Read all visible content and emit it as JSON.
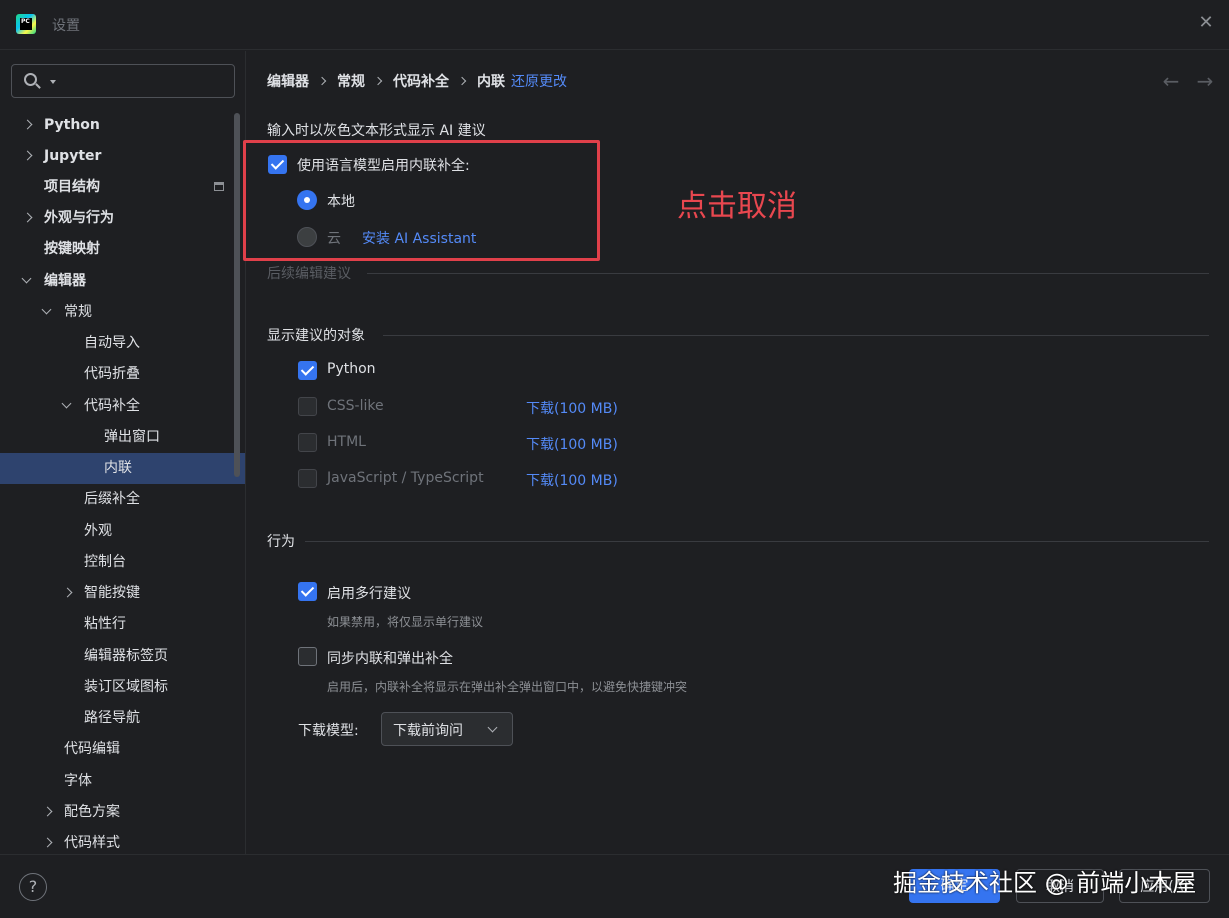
{
  "window": {
    "title": "设置",
    "logo_text": "PC"
  },
  "search": {
    "placeholder": ""
  },
  "sidebar": {
    "items": [
      {
        "label": "Python"
      },
      {
        "label": "Jupyter"
      },
      {
        "label": "项目结构"
      },
      {
        "label": "外观与行为"
      },
      {
        "label": "按键映射"
      },
      {
        "label": "编辑器"
      },
      {
        "label": "常规"
      },
      {
        "label": "自动导入"
      },
      {
        "label": "代码折叠"
      },
      {
        "label": "代码补全"
      },
      {
        "label": "弹出窗口"
      },
      {
        "label": "内联",
        "selected": true
      },
      {
        "label": "后缀补全"
      },
      {
        "label": "外观"
      },
      {
        "label": "控制台"
      },
      {
        "label": "智能按键"
      },
      {
        "label": "粘性行"
      },
      {
        "label": "编辑器标签页"
      },
      {
        "label": "装订区域图标"
      },
      {
        "label": "路径导航"
      },
      {
        "label": "代码编辑"
      },
      {
        "label": "字体"
      },
      {
        "label": "配色方案"
      },
      {
        "label": "代码样式"
      }
    ]
  },
  "breadcrumb": {
    "items": [
      "编辑器",
      "常规",
      "代码补全",
      "内联"
    ],
    "restore": "还原更改"
  },
  "main": {
    "hint": "输入时以灰色文本形式显示 AI 建议",
    "inline_completion": {
      "label": "使用语言模型启用内联补全:",
      "checked": true
    },
    "radio_local": {
      "label": "本地",
      "selected": true
    },
    "radio_cloud": {
      "label": "云",
      "selected": false
    },
    "install_link": "安装 AI Assistant",
    "followup_section": "后续编辑建议",
    "languages_section": "显示建议的对象",
    "languages": [
      {
        "label": "Python",
        "checked": true,
        "enabled": true,
        "download": ""
      },
      {
        "label": "CSS-like",
        "checked": false,
        "enabled": false,
        "download": "下载(100 MB)"
      },
      {
        "label": "HTML",
        "checked": false,
        "enabled": false,
        "download": "下载(100 MB)"
      },
      {
        "label": "JavaScript / TypeScript",
        "checked": false,
        "enabled": false,
        "download": "下载(100 MB)"
      }
    ],
    "behavior_section": "行为",
    "multiline": {
      "label": "启用多行建议",
      "desc": "如果禁用，将仅显示单行建议",
      "checked": true
    },
    "sync": {
      "label": "同步内联和弹出补全",
      "desc": "启用后，内联补全将显示在弹出补全弹出窗口中，以避免快捷键冲突",
      "checked": false
    },
    "download_model": {
      "label": "下载模型:",
      "value": "下载前询问"
    }
  },
  "annotation": {
    "text": "点击取消",
    "color": "#e8474f"
  },
  "footer": {
    "help": "?",
    "ok": "确定",
    "cancel": "取消",
    "apply": "应用(A)"
  },
  "watermark": "掘金技术社区 @ 前端小木屋",
  "colors": {
    "accent": "#3574f0",
    "link": "#548af7",
    "selection": "#2e436e",
    "background": "#1e1f22"
  }
}
